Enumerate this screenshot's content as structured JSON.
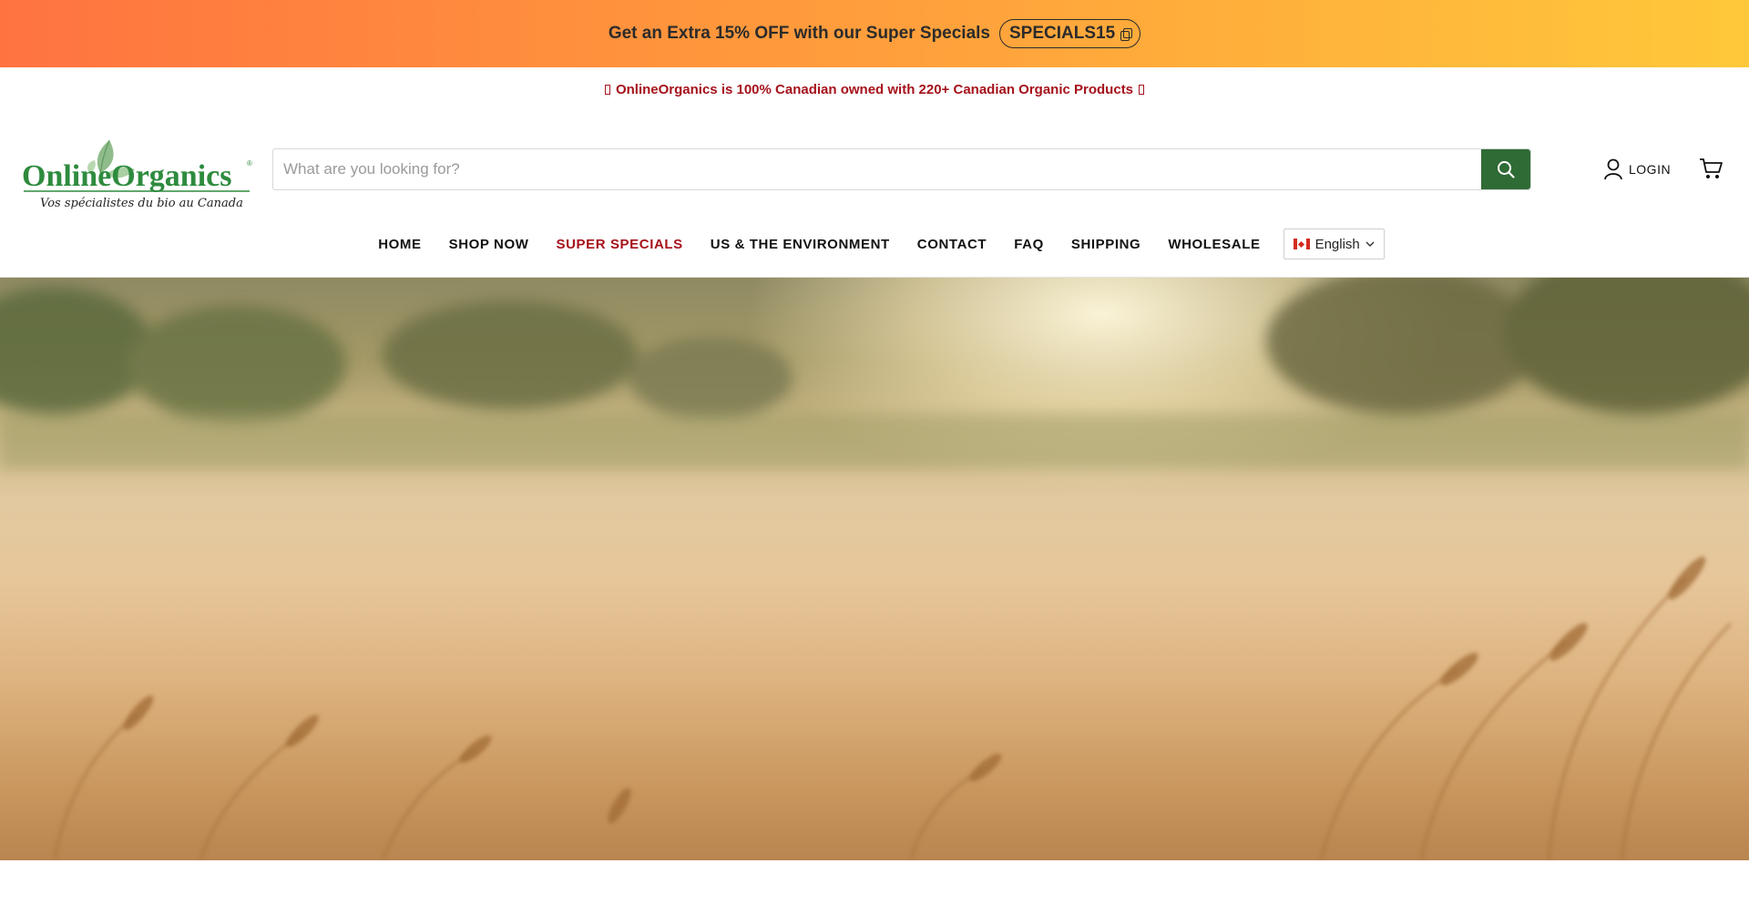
{
  "promo": {
    "text": "Get an Extra 15% OFF with our Super Specials",
    "code": "SPECIALS15"
  },
  "announcement": {
    "text": "OnlineOrganics is 100% Canadian owned with 220+ Canadian Organic Products"
  },
  "logo": {
    "name": "OnlineOrganics",
    "tagline": "Vos spécialistes du bio au Canada",
    "brand_color": "#2e8b3e"
  },
  "search": {
    "placeholder": "What are you looking for?",
    "button_color": "#2f6b35"
  },
  "account": {
    "login_label": "LOGIN"
  },
  "nav": {
    "items": [
      {
        "label": "HOME"
      },
      {
        "label": "SHOP NOW"
      },
      {
        "label": "SUPER SPECIALS"
      },
      {
        "label": "US & THE ENVIRONMENT"
      },
      {
        "label": "CONTACT"
      },
      {
        "label": "FAQ"
      },
      {
        "label": "SHIPPING"
      },
      {
        "label": "WHOLESALE"
      }
    ],
    "accent_color": "#a5121b",
    "language": "English"
  },
  "icons": {
    "copy": "copy-icon",
    "search": "search-icon",
    "user": "user-icon",
    "cart": "cart-icon",
    "chevron": "chevron-down-icon",
    "flag": "canada-flag-icon"
  }
}
